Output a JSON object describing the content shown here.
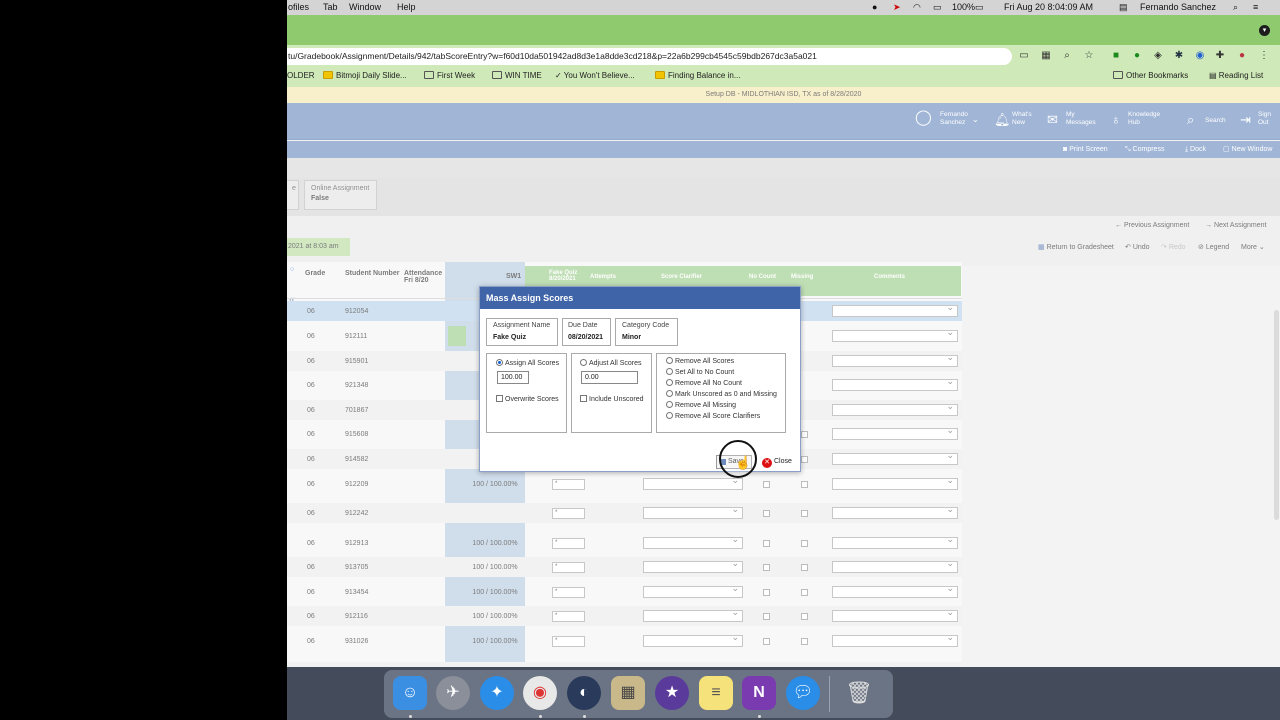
{
  "menubar": {
    "items": [
      "ofiles",
      "Tab",
      "Window",
      "Help"
    ],
    "battery": "100%",
    "datetime": "Fri Aug 20  8:04:09 AM",
    "user": "Fernando Sanchez"
  },
  "browser": {
    "url": "tu/Gradebook/Assignment/Details/942/tabScoreEntry?w=f60d10da501942ad8d3e1a8dde3cd218&p=22a6b299cb4545c59bdb267dc3a5a021",
    "bookmarks": [
      "OLDER",
      "Bitmoji Daily Slide...",
      "First Week",
      "WIN TIME",
      "You Won't Believe...",
      "Finding Balance in..."
    ],
    "other_bookmarks": "Other Bookmarks",
    "reading_list": "Reading List"
  },
  "app": {
    "setup_text": "Setup DB - MIDLOTHIAN ISD, TX as of 8/28/2020",
    "header_items": [
      {
        "label": "Fernando Sanchez",
        "icon": "user-icon"
      },
      {
        "label": "What's New",
        "icon": "bell-icon"
      },
      {
        "label": "My Messages",
        "icon": "mail-icon"
      },
      {
        "label": "Knowledge Hub",
        "icon": "lightbulb-icon"
      },
      {
        "label": "Search",
        "icon": "search-icon"
      },
      {
        "label": "Sign Out",
        "icon": "signout-icon"
      }
    ],
    "tools": [
      "Print Screen",
      "Compress",
      "Dock",
      "New Window"
    ],
    "info_partial": "e",
    "info_online_label": "Online Assignment",
    "info_online_value": "False",
    "nav": {
      "previous": "Previous Assignment",
      "next": "Next Assignment",
      "return": "Return to Gradesheet",
      "undo": "Undo",
      "redo": "Redo",
      "legend": "Legend",
      "more": "More"
    },
    "saved_badge": "2021 at 8:03 am"
  },
  "grid": {
    "headers": {
      "grade": "Grade",
      "student_number": "Student Number",
      "attendance": "Attendance Fri 8/20",
      "sw1": "SW1",
      "fake_quiz": "Fake Quiz 8/20/2021",
      "attempts": "Attempts",
      "score_clarifier": "Score Clarifier",
      "no_count": "No Count",
      "missing": "Missing",
      "comments": "Comments"
    },
    "rows": [
      {
        "grade": "06",
        "number": "912054",
        "sw1": "",
        "fq": ""
      },
      {
        "grade": "06",
        "number": "912111",
        "sw1": "",
        "fq": ""
      },
      {
        "grade": "06",
        "number": "915901",
        "sw1": "",
        "fq": ""
      },
      {
        "grade": "06",
        "number": "921348",
        "sw1": "",
        "fq": ""
      },
      {
        "grade": "06",
        "number": "701867",
        "sw1": "",
        "fq": ""
      },
      {
        "grade": "06",
        "number": "915608",
        "sw1": "",
        "fq": ""
      },
      {
        "grade": "06",
        "number": "914582",
        "sw1": "",
        "fq": ""
      },
      {
        "grade": "06",
        "number": "912209",
        "sw1": "100 / 100.00%",
        "fq": "*"
      },
      {
        "grade": "06",
        "number": "912242",
        "sw1": "",
        "fq": "*"
      },
      {
        "grade": "06",
        "number": "912913",
        "sw1": "100 / 100.00%",
        "fq": "*"
      },
      {
        "grade": "06",
        "number": "913705",
        "sw1": "100 / 100.00%",
        "fq": "*"
      },
      {
        "grade": "06",
        "number": "913454",
        "sw1": "100 / 100.00%",
        "fq": "*"
      },
      {
        "grade": "06",
        "number": "912116",
        "sw1": "100 / 100.00%",
        "fq": "*"
      },
      {
        "grade": "06",
        "number": "931026",
        "sw1": "100 / 100.00%",
        "fq": "*"
      }
    ]
  },
  "modal": {
    "title": "Mass Assign Scores",
    "assignment_name_label": "Assignment Name",
    "assignment_name": "Fake Quiz",
    "due_date_label": "Due Date",
    "due_date": "08/20/2021",
    "category_label": "Category Code",
    "category": "Minor",
    "assign_all": "Assign All Scores",
    "assign_value": "100.00",
    "overwrite": "Overwrite Scores",
    "adjust_all": "Adjust All Scores",
    "adjust_value": "0.00",
    "include_unscored": "Include Unscored",
    "options": [
      "Remove All Scores",
      "Set All to No Count",
      "Remove All No Count",
      "Mark Unscored as 0 and Missing",
      "Remove All Missing",
      "Remove All Score Clarifiers"
    ],
    "save": "Save",
    "close": "Close"
  }
}
